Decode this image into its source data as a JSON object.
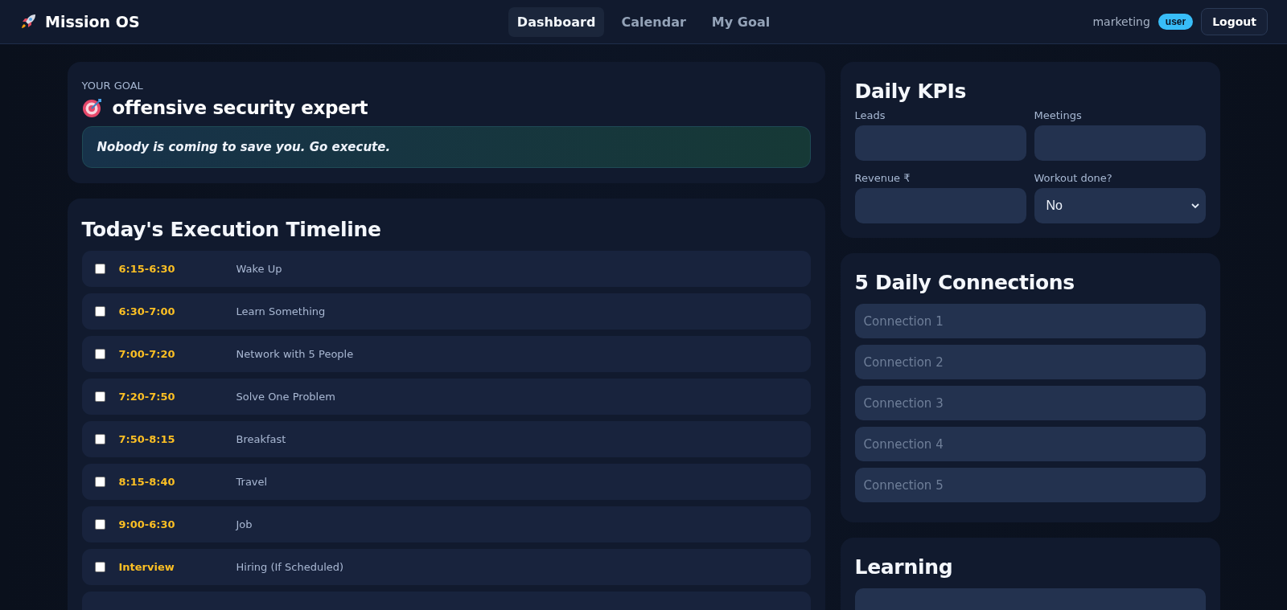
{
  "brand": {
    "name": "Mission OS"
  },
  "nav": [
    {
      "label": "Dashboard",
      "selected": true
    },
    {
      "label": "Calendar",
      "selected": false
    },
    {
      "label": "My Goal",
      "selected": false
    }
  ],
  "user": {
    "name": "marketing",
    "role": "user"
  },
  "logout": "Logout",
  "goal": {
    "eyebrow": "YOUR GOAL",
    "title": "offensive security expert",
    "quote": "Nobody is coming to save you. Go execute."
  },
  "timeline": {
    "title": "Today's Execution Timeline",
    "rows": [
      {
        "time": "6:15-6:30",
        "task": "Wake Up",
        "checked": false
      },
      {
        "time": "6:30-7:00",
        "task": "Learn Something",
        "checked": false
      },
      {
        "time": "7:00-7:20",
        "task": "Network with 5 People",
        "checked": false
      },
      {
        "time": "7:20-7:50",
        "task": "Solve One Problem",
        "checked": false
      },
      {
        "time": "7:50-8:15",
        "task": "Breakfast",
        "checked": false
      },
      {
        "time": "8:15-8:40",
        "task": "Travel",
        "checked": false
      },
      {
        "time": "9:00-6:30",
        "task": "Job",
        "checked": false
      },
      {
        "time": "Interview",
        "task": "Hiring (If Scheduled)",
        "checked": false
      }
    ]
  },
  "kpis": {
    "title": "Daily KPIs",
    "fields": [
      {
        "kind": "input",
        "label": "Leads"
      },
      {
        "kind": "input",
        "label": "Meetings"
      },
      {
        "kind": "input",
        "label": "Revenue ₹"
      },
      {
        "kind": "select",
        "label": "Workout done?",
        "value": "No"
      }
    ]
  },
  "connections": {
    "title": "5 Daily Connections",
    "fields": [
      {
        "placeholder": "Connection 1"
      },
      {
        "placeholder": "Connection 2"
      },
      {
        "placeholder": "Connection 3"
      },
      {
        "placeholder": "Connection 4"
      },
      {
        "placeholder": "Connection 5"
      }
    ]
  },
  "learning": {
    "title": "Learning"
  }
}
